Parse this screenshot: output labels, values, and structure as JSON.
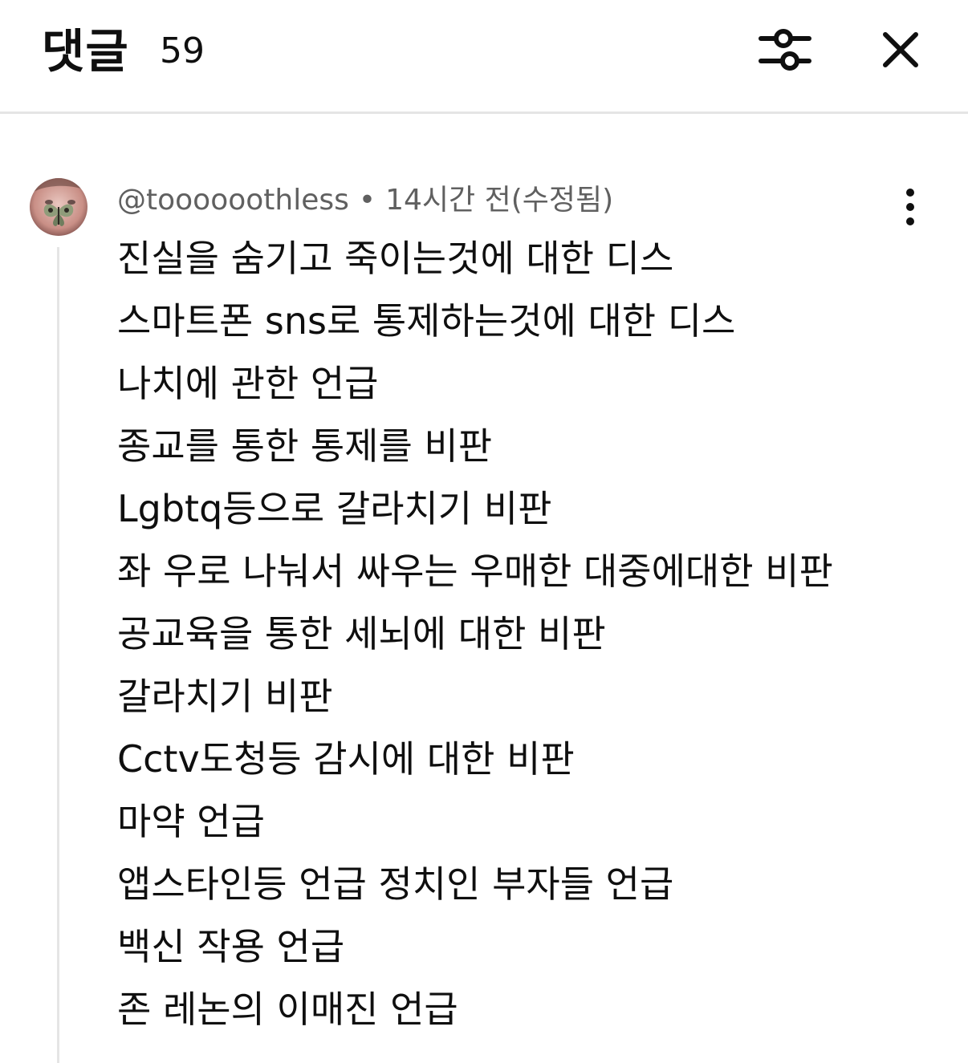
{
  "header": {
    "title": "댓글",
    "count": "59"
  },
  "comment": {
    "author": "@toooooothless",
    "separator": "•",
    "time": "14시간 전(수정됨)",
    "lines": [
      "진실을 숨기고 죽이는것에 대한 디스",
      "스마트폰 sns로 통제하는것에 대한 디스",
      "나치에 관한 언급",
      "종교를 통한 통제를 비판",
      "Lgbtq등으로 갈라치기 비판",
      "좌 우로 나눠서 싸우는 우매한 대중에대한 비판",
      "공교육을 통한 세뇌에 대한 비판",
      "갈라치기 비판",
      "Cctv도청등 감시에 대한 비판",
      "마약 언급",
      "앱스타인등 언급 정치인 부자들 언급",
      "백신 작용 언급",
      "존 레논의 이매진 언급"
    ]
  },
  "icons": {
    "filter": "filter-sliders-icon",
    "close": "close-icon",
    "more": "more-vertical-icon",
    "avatar": "butterfly-avatar"
  },
  "colors": {
    "text": "#0f0f0f",
    "secondary_text": "#606060",
    "divider": "#e5e5e5",
    "background": "#ffffff"
  }
}
